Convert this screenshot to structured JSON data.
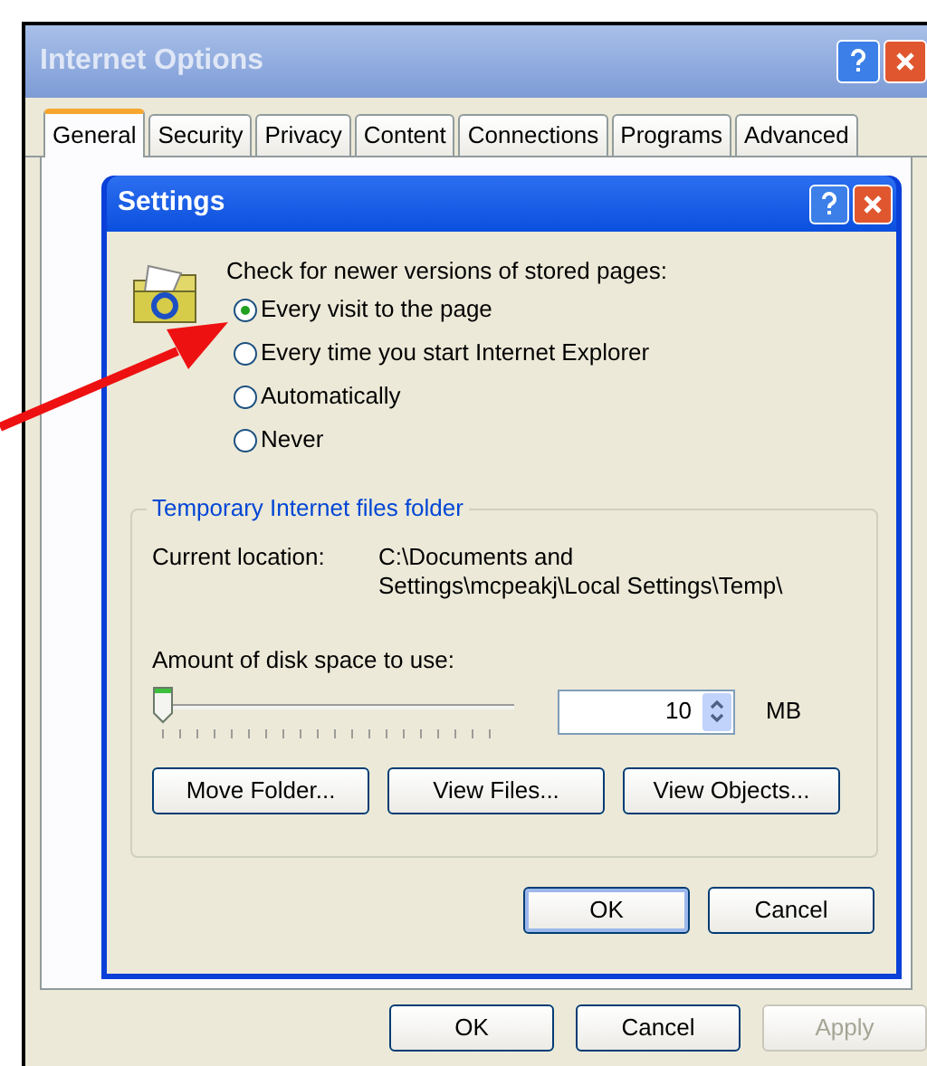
{
  "window": {
    "title": "Internet Options"
  },
  "tabs": [
    {
      "label": "General",
      "selected": true
    },
    {
      "label": "Security",
      "selected": false
    },
    {
      "label": "Privacy",
      "selected": false
    },
    {
      "label": "Content",
      "selected": false
    },
    {
      "label": "Connections",
      "selected": false
    },
    {
      "label": "Programs",
      "selected": false
    },
    {
      "label": "Advanced",
      "selected": false
    }
  ],
  "buttons": [
    {
      "label": "OK",
      "disabled": false
    },
    {
      "label": "Cancel",
      "disabled": false
    },
    {
      "label": "Apply",
      "disabled": true
    }
  ],
  "settings_dialog": {
    "title": "Settings",
    "prompt": "Check for newer versions of stored pages:",
    "options": [
      {
        "label": "Every visit to the page",
        "selected": true
      },
      {
        "label": "Every time you start Internet Explorer",
        "selected": false
      },
      {
        "label": "Automatically",
        "selected": false
      },
      {
        "label": "Never",
        "selected": false
      }
    ],
    "group": {
      "title": "Temporary Internet files folder",
      "current_location_label": "Current location:",
      "current_location_lines": [
        "C:\\Documents and",
        "Settings\\mcpeakj\\Local Settings\\Temp\\"
      ],
      "disk_space_label": "Amount of disk space to use:",
      "slider": {
        "level": 0
      },
      "disk_space_value": "10",
      "unit": "MB",
      "buttons": [
        "Move Folder...",
        "View Files...",
        "View Objects..."
      ]
    },
    "buttons": [
      "OK",
      "Cancel"
    ]
  }
}
